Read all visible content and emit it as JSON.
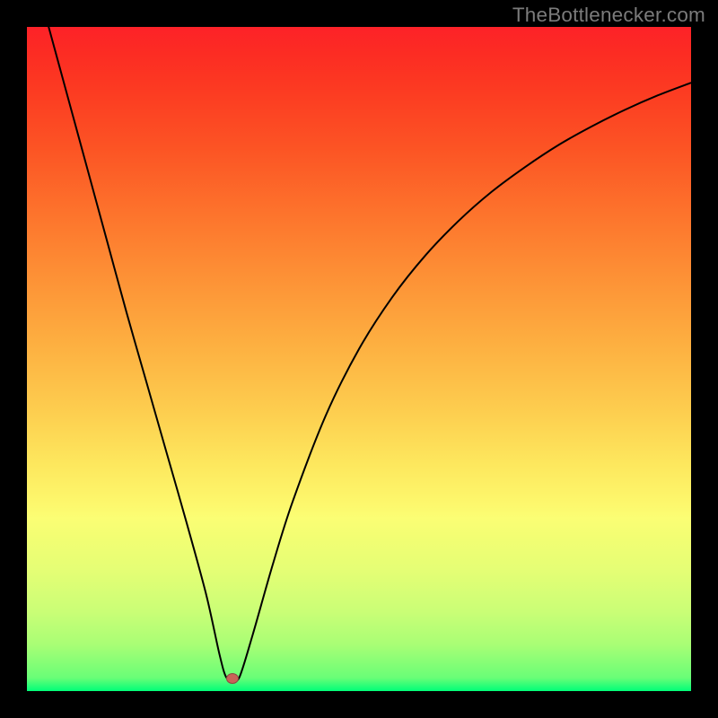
{
  "watermark": "TheBottlenecker.com",
  "chart_data": {
    "type": "line",
    "title": "",
    "xlabel": "",
    "ylabel": "",
    "xlim": [
      0,
      100
    ],
    "ylim": [
      0,
      100
    ],
    "series": [
      {
        "name": "bottleneck-curve",
        "x": [
          3,
          6,
          9,
          12,
          15,
          18,
          21,
          24,
          27,
          29,
          30,
          31,
          32,
          34,
          37,
          40,
          45,
          50,
          55,
          60,
          65,
          70,
          75,
          80,
          85,
          90,
          95,
          100
        ],
        "values": [
          101,
          90,
          79,
          68,
          57,
          46.5,
          36,
          25.5,
          14.5,
          5.5,
          2.1,
          1.9,
          2.1,
          8.5,
          19,
          28.5,
          41.5,
          51.5,
          59.3,
          65.6,
          70.8,
          75.2,
          78.9,
          82.2,
          85,
          87.5,
          89.7,
          91.6
        ]
      }
    ],
    "marker": {
      "x": 31,
      "y": 1.9
    },
    "gradient_direction": "top-red-to-bottom-green"
  }
}
